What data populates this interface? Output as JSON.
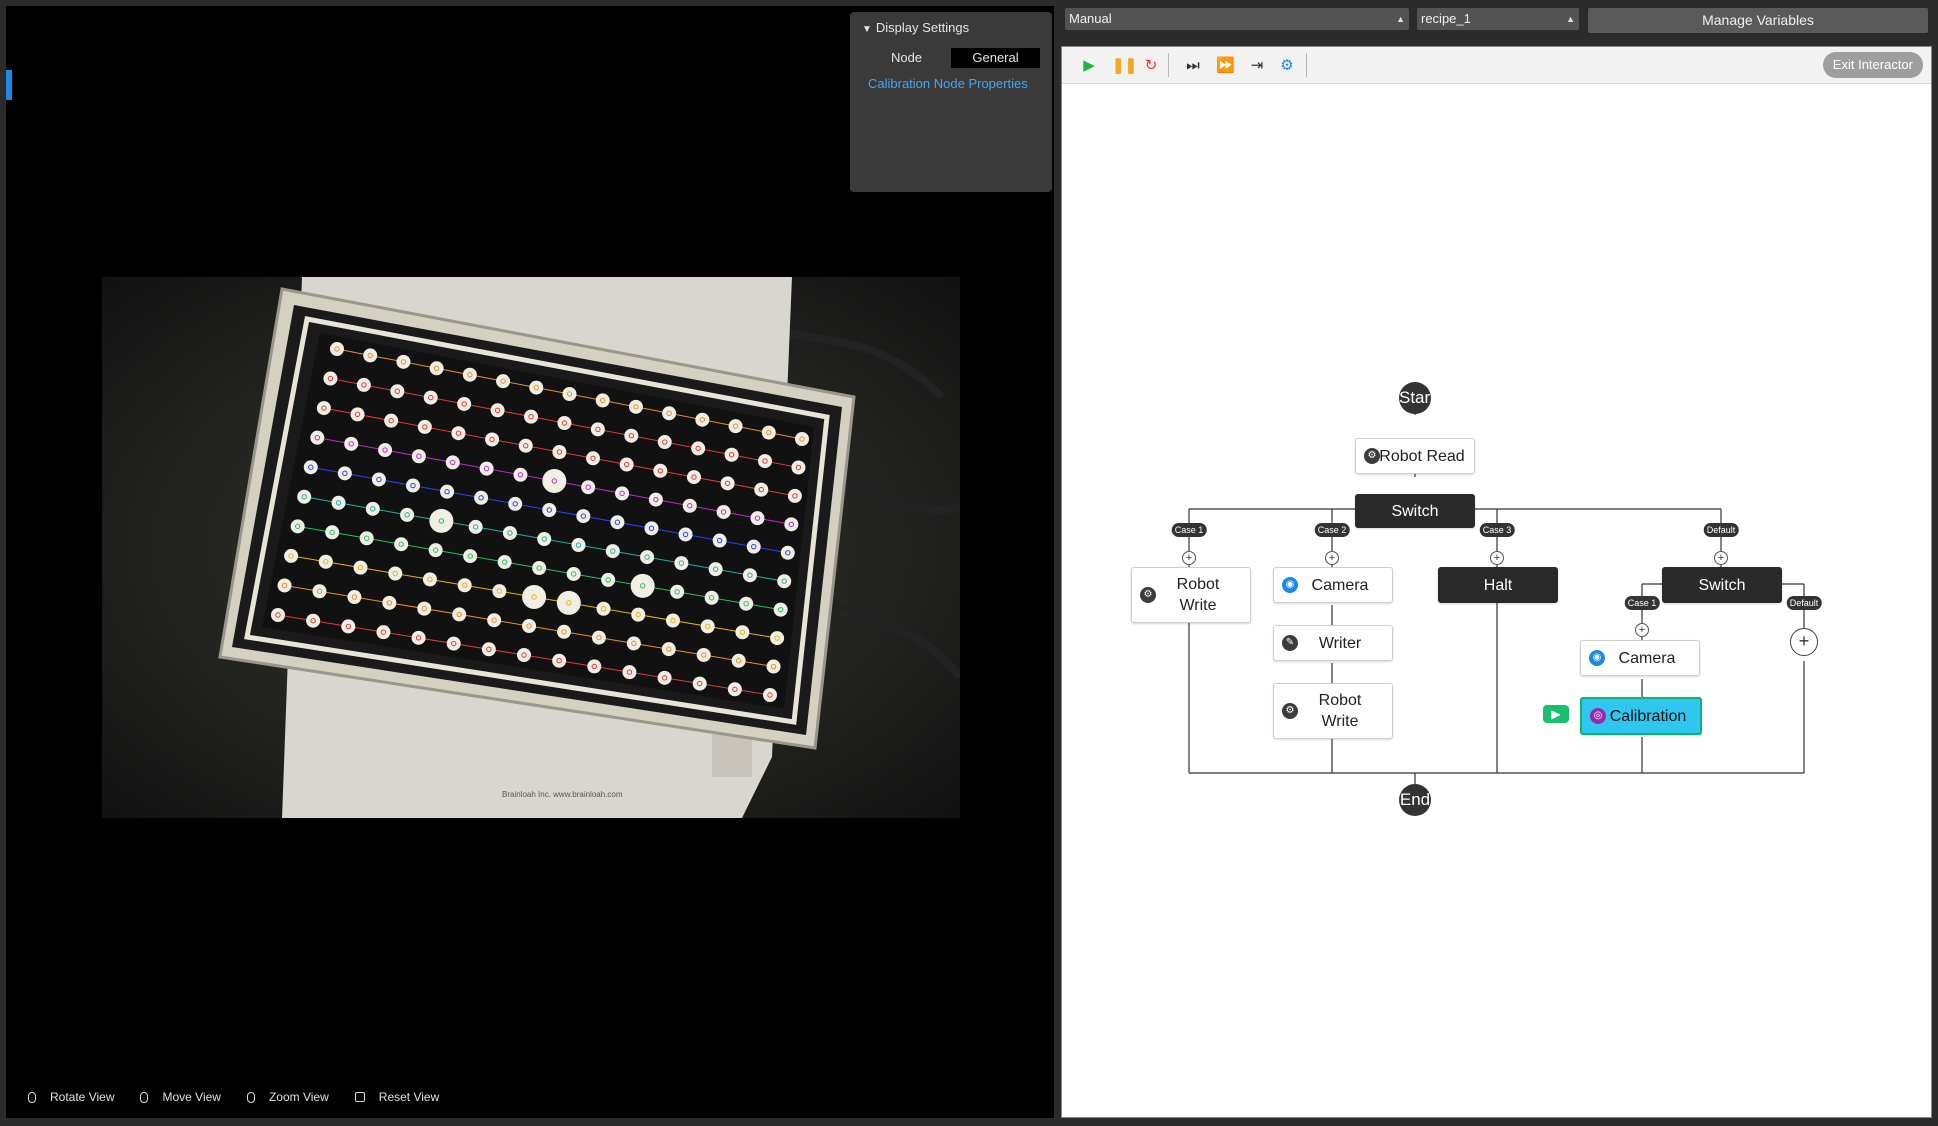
{
  "viewer": {
    "display_settings": {
      "title": "Display Settings",
      "tabs": [
        "Node",
        "General"
      ],
      "active_tab": "General",
      "link": "Calibration Node Properties"
    },
    "controls": [
      {
        "label": "Rotate View",
        "icon": "mouse-left-icon"
      },
      {
        "label": "Move View",
        "icon": "mouse-right-icon"
      },
      {
        "label": "Zoom View",
        "icon": "mouse-scroll-icon"
      },
      {
        "label": "Reset View",
        "icon": "reset-key-icon"
      }
    ]
  },
  "top_bar": {
    "mode_select": "Manual",
    "recipe_select": "recipe_1",
    "manage_variables": "Manage Variables"
  },
  "toolbar": {
    "exit_label": "Exit Interactor",
    "buttons": [
      "play-icon",
      "pause-icon",
      "restart-icon",
      "step-icon",
      "fast-forward-icon",
      "step-into-icon",
      "debug-robot-icon"
    ]
  },
  "flow": {
    "start_label": "Start",
    "end_label": "End",
    "robot_read": "Robot Read",
    "switch_label": "Switch",
    "cases": [
      "Case 1",
      "Case 2",
      "Case 3",
      "Default"
    ],
    "robot_write_1": "Robot Write",
    "camera_1": "Camera",
    "writer": "Writer",
    "robot_write_2": "Robot Write",
    "halt": "Halt",
    "switch_2_label": "Switch",
    "cases_2": [
      "Case 1",
      "Default"
    ],
    "camera_2": "Camera",
    "calibration": "Calibration"
  },
  "colors": {
    "accent": "#1e88e5",
    "link": "#3ea8f5",
    "calibration_fill": "#2fc6f0",
    "running": "#19c06b"
  }
}
